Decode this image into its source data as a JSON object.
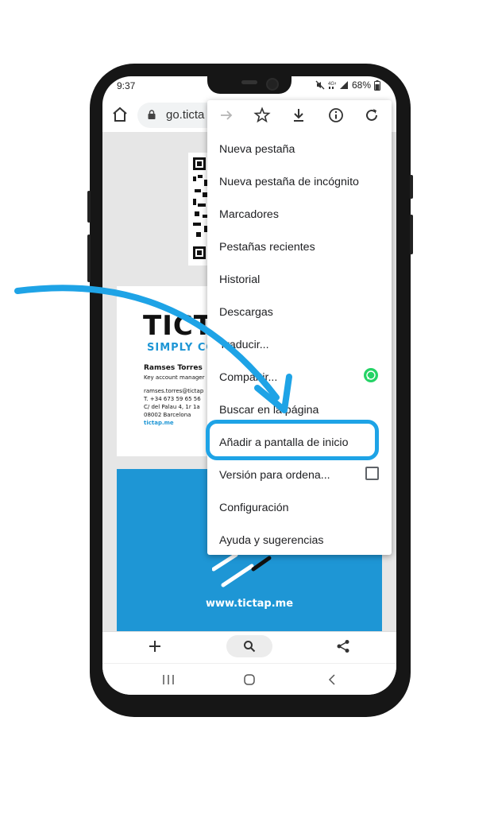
{
  "status_bar": {
    "time": "9:37",
    "battery": "68%"
  },
  "browser": {
    "url": "go.ticta",
    "icons": [
      "home-icon",
      "lock-icon",
      "forward-arrow-icon",
      "star-icon",
      "download-icon",
      "info-icon",
      "reload-icon"
    ]
  },
  "page": {
    "logo": "TICTAP",
    "tagline": "SIMPLY CO",
    "person_name": "Ramses Torres",
    "person_role": "Key account manager",
    "email": "ramses.torres@tictap",
    "phone": "T. +34 673 59 65 56",
    "address_1": "C/ del Palau 4, 1r 1a",
    "address_2": "08002 Barcelona",
    "site_short": "tictap.me",
    "website": "www.tictap.me"
  },
  "menu": {
    "items": [
      {
        "label": "Nueva pestaña"
      },
      {
        "label": "Nueva pestaña de incógnito"
      },
      {
        "label": "Marcadores"
      },
      {
        "label": "Pestañas recientes"
      },
      {
        "label": "Historial"
      },
      {
        "label": "Descargas"
      },
      {
        "label": "Traducir..."
      },
      {
        "label": "Compartir..."
      },
      {
        "label": "Buscar en la página"
      },
      {
        "label": "Añadir a pantalla de inicio"
      },
      {
        "label": "Versión para ordena..."
      },
      {
        "label": "Configuración"
      },
      {
        "label": "Ayuda y sugerencias"
      }
    ],
    "highlighted_item": "Añadir a pantalla de inicio"
  },
  "bottom_bar": {
    "icons": [
      "plus-icon",
      "search-icon",
      "share-icon"
    ]
  },
  "nav_bar": {
    "icons": [
      "recent-apps-icon",
      "home-nav-icon",
      "back-icon"
    ]
  },
  "colors": {
    "accent": "#1ea3e6",
    "brand_blue": "#1e96d5",
    "whatsapp": "#25d366"
  }
}
